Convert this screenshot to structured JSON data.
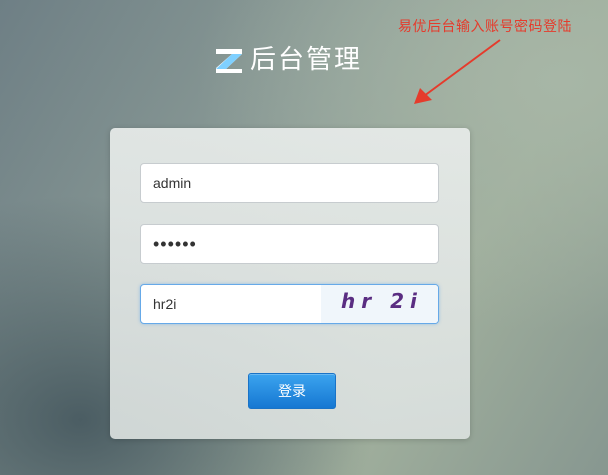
{
  "annotation": {
    "text": "易优后台输入账号密码登陆",
    "color": "#e53b2c"
  },
  "brand": {
    "logo_icon": "z-logo-icon",
    "title": "后台管理"
  },
  "login": {
    "username_value": "admin",
    "password_value": "••••••",
    "captcha_value": "hr2i",
    "captcha_image_text": "hr 2i",
    "submit_label": "登录"
  },
  "colors": {
    "accent": "#1677d2",
    "focus_border": "#66a9e8",
    "annotation": "#e53b2c"
  }
}
